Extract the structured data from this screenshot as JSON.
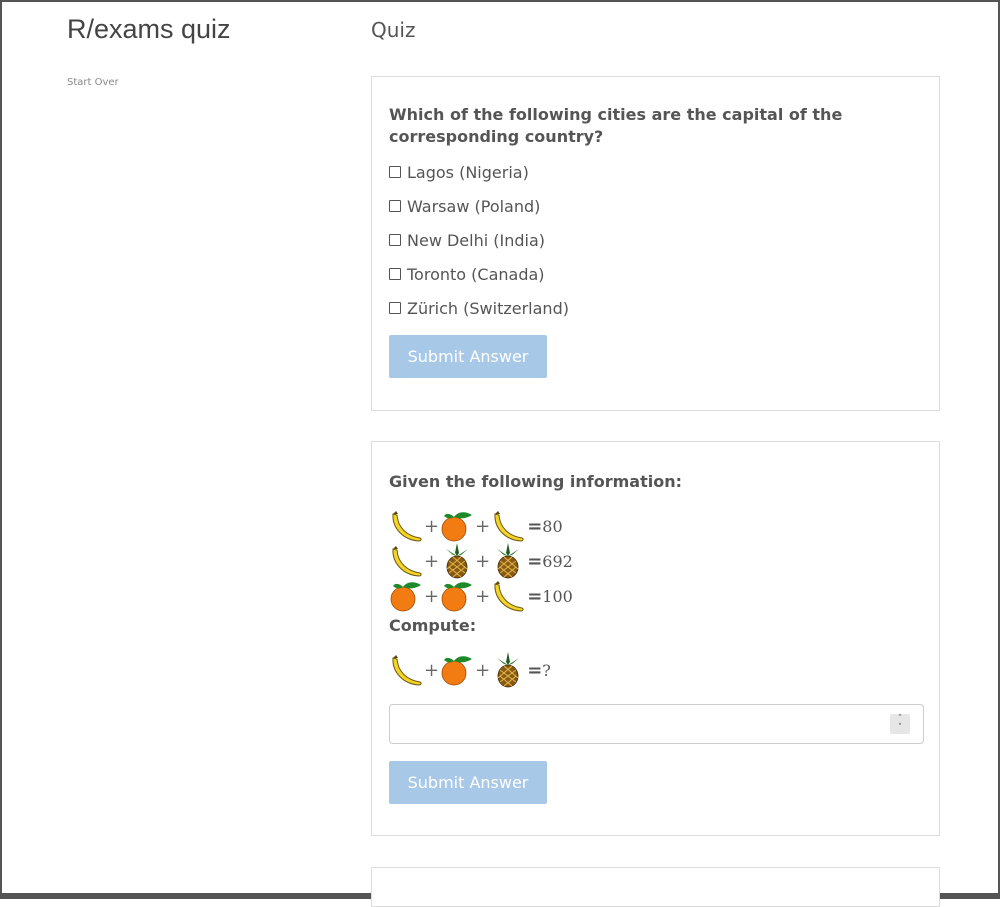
{
  "app": {
    "title": "R/exams quiz",
    "start_over": "Start Over"
  },
  "page": {
    "heading": "Quiz"
  },
  "question1": {
    "text": "Which of the following cities are the capital of the corresponding country?",
    "options": [
      "Lagos (Nigeria)",
      "Warsaw (Poland)",
      "New Delhi (India)",
      "Toronto (Canada)",
      "Zürich (Switzerland)"
    ],
    "submit_label": "Submit Answer"
  },
  "question2": {
    "intro": "Given the following information:",
    "equations": [
      {
        "terms": [
          "banana",
          "orange",
          "banana"
        ],
        "result": "80"
      },
      {
        "terms": [
          "banana",
          "pineapple",
          "pineapple"
        ],
        "result": "692"
      },
      {
        "terms": [
          "orange",
          "orange",
          "banana"
        ],
        "result": "100"
      }
    ],
    "compute_label": "Compute:",
    "target": {
      "terms": [
        "banana",
        "orange",
        "pineapple"
      ],
      "result": "?"
    },
    "plus": "+",
    "equals": "=",
    "input_value": "",
    "submit_label": "Submit Answer"
  },
  "colors": {
    "submit_bg": "#a8c8e8",
    "banana": "#f5d327",
    "orange": "#f27c12",
    "leaf": "#1c8a2a",
    "pineapple": "#8a5a14"
  }
}
